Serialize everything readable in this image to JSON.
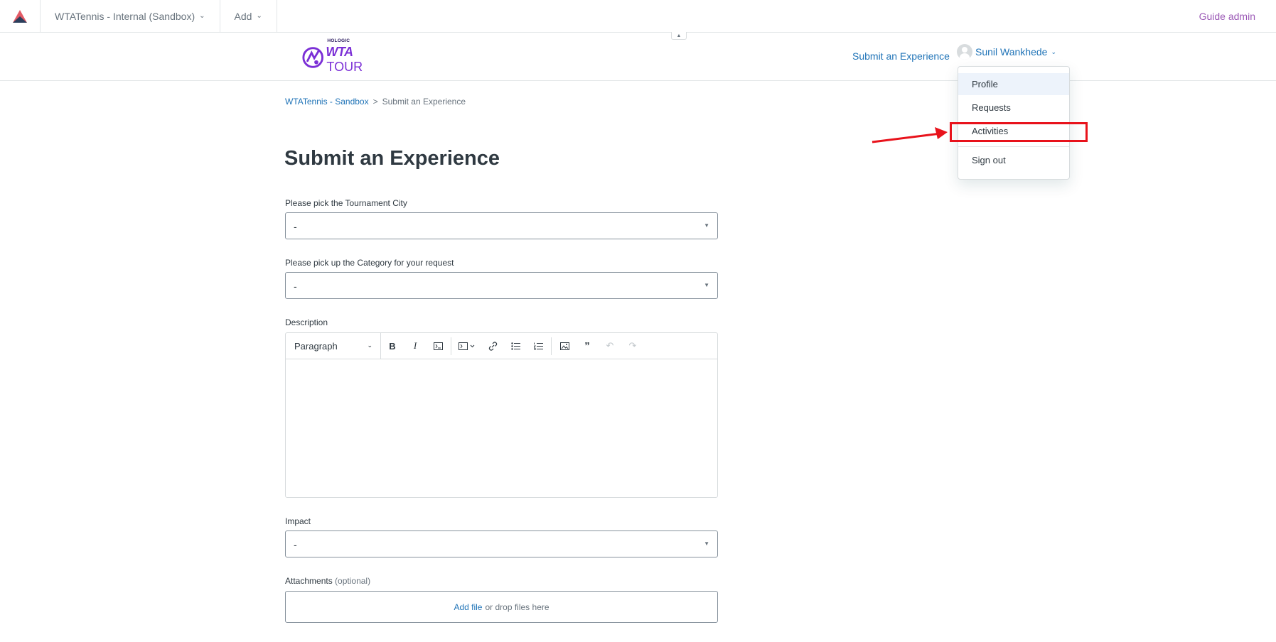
{
  "adminbar": {
    "brand_selector": "WTATennis - Internal (Sandbox)",
    "add_label": "Add",
    "guide_admin": "Guide admin"
  },
  "header": {
    "brand_hologic": "HOLOGIC",
    "brand_wta": "WTA",
    "brand_tour": "TOUR",
    "submit_link": "Submit an Experience",
    "user_name": "Sunil Wankhede"
  },
  "user_menu": {
    "items": [
      {
        "label": "Profile"
      },
      {
        "label": "Requests"
      },
      {
        "label": "Activities"
      },
      {
        "label": "Sign out"
      }
    ]
  },
  "breadcrumb": {
    "home": "WTATennis - Sandbox",
    "separator": ">",
    "current": "Submit an Experience"
  },
  "form": {
    "title": "Submit an Experience",
    "tournament_city": {
      "label": "Please pick the Tournament City",
      "value": "-"
    },
    "category": {
      "label": "Please pick up the Category for your request",
      "value": "-"
    },
    "description": {
      "label": "Description",
      "paragraph_style": "Paragraph"
    },
    "impact": {
      "label": "Impact",
      "value": "-"
    },
    "attachments": {
      "label": "Attachments",
      "optional": "(optional)",
      "add_file": "Add file",
      "drop_text": "or drop files here"
    }
  },
  "colors": {
    "link": "#1f73b7",
    "guide_admin": "#9b59b6",
    "annotation": "#e8121b",
    "brand": "#7b2fd6"
  }
}
